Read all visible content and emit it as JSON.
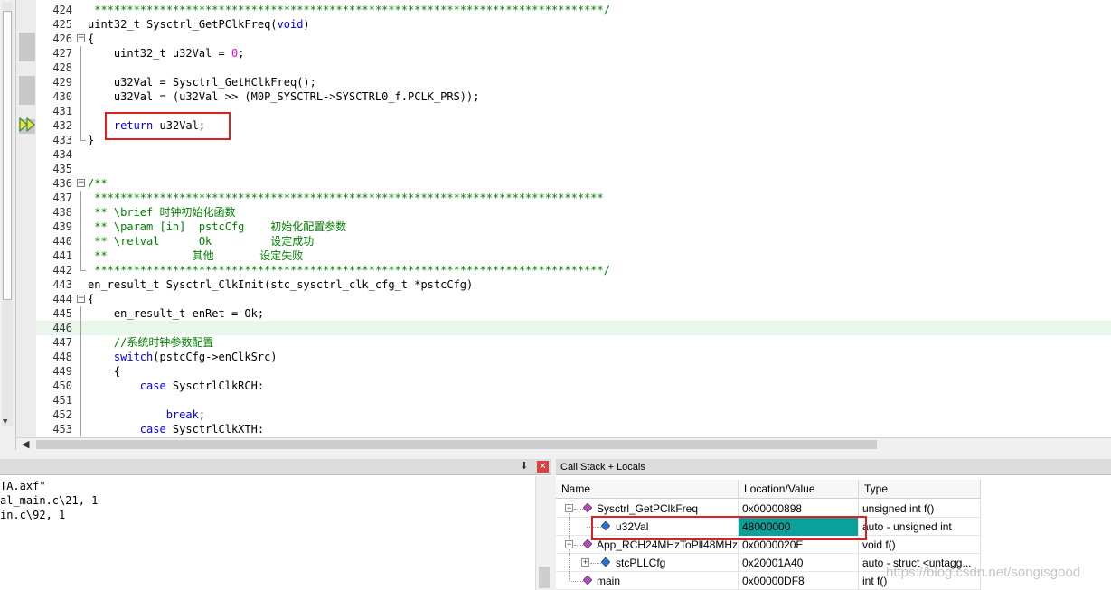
{
  "editor": {
    "lines": [
      {
        "n": "424",
        "segs": [
          {
            "t": " ******************************************************************************/",
            "c": "cmt"
          }
        ]
      },
      {
        "n": "425",
        "segs": [
          {
            "t": "uint32_t Sysctrl_GetPClkFreq(",
            "c": ""
          },
          {
            "t": "void",
            "c": "kw"
          },
          {
            "t": ")",
            "c": ""
          }
        ]
      },
      {
        "n": "426",
        "segs": [
          {
            "t": "{",
            "c": ""
          }
        ]
      },
      {
        "n": "427",
        "segs": [
          {
            "t": "    uint32_t u32Val = ",
            "c": ""
          },
          {
            "t": "0",
            "c": "num"
          },
          {
            "t": ";",
            "c": ""
          }
        ]
      },
      {
        "n": "428",
        "segs": []
      },
      {
        "n": "429",
        "segs": [
          {
            "t": "    u32Val = Sysctrl_GetHClkFreq();",
            "c": ""
          }
        ]
      },
      {
        "n": "430",
        "segs": [
          {
            "t": "    u32Val = (u32Val >> (M0P_SYSCTRL->SYSCTRL0_f.PCLK_PRS));",
            "c": ""
          }
        ]
      },
      {
        "n": "431",
        "segs": []
      },
      {
        "n": "432",
        "segs": [
          {
            "t": "    ",
            "c": ""
          },
          {
            "t": "return",
            "c": "kw"
          },
          {
            "t": " u32Val;",
            "c": ""
          }
        ]
      },
      {
        "n": "433",
        "segs": [
          {
            "t": "}",
            "c": ""
          }
        ]
      },
      {
        "n": "434",
        "segs": []
      },
      {
        "n": "435",
        "segs": []
      },
      {
        "n": "436",
        "segs": [
          {
            "t": "/**",
            "c": "cmt"
          }
        ]
      },
      {
        "n": "437",
        "segs": [
          {
            "t": " ******************************************************************************",
            "c": "cmt"
          }
        ]
      },
      {
        "n": "438",
        "segs": [
          {
            "t": " ** \\brief ",
            "c": "cmt"
          },
          {
            "t": "时钟初始化函数",
            "c": "cmt cjk"
          }
        ]
      },
      {
        "n": "439",
        "segs": [
          {
            "t": " ** \\param [in]  pstcCfg    ",
            "c": "cmt"
          },
          {
            "t": "初始化配置参数",
            "c": "cmt cjk"
          }
        ]
      },
      {
        "n": "440",
        "segs": [
          {
            "t": " ** \\retval      Ok         ",
            "c": "cmt"
          },
          {
            "t": "设定成功",
            "c": "cmt cjk"
          }
        ]
      },
      {
        "n": "441",
        "segs": [
          {
            "t": " **             ",
            "c": "cmt"
          },
          {
            "t": "其他",
            "c": "cmt cjk"
          },
          {
            "t": "       ",
            "c": "cmt"
          },
          {
            "t": "设定失败",
            "c": "cmt cjk"
          }
        ]
      },
      {
        "n": "442",
        "segs": [
          {
            "t": " ******************************************************************************/",
            "c": "cmt"
          }
        ]
      },
      {
        "n": "443",
        "segs": [
          {
            "t": "en_result_t Sysctrl_ClkInit(stc_sysctrl_clk_cfg_t *pstcCfg)",
            "c": ""
          }
        ]
      },
      {
        "n": "444",
        "segs": [
          {
            "t": "{",
            "c": ""
          }
        ]
      },
      {
        "n": "445",
        "segs": [
          {
            "t": "    en_result_t enRet = Ok;",
            "c": ""
          }
        ]
      },
      {
        "n": "446",
        "segs": []
      },
      {
        "n": "447",
        "segs": [
          {
            "t": "    //",
            "c": "cmt"
          },
          {
            "t": "系统时钟参数配置",
            "c": "cmt cjk"
          }
        ]
      },
      {
        "n": "448",
        "segs": [
          {
            "t": "    ",
            "c": ""
          },
          {
            "t": "switch",
            "c": "kw"
          },
          {
            "t": "(pstcCfg->enClkSrc)",
            "c": ""
          }
        ]
      },
      {
        "n": "449",
        "segs": [
          {
            "t": "    {",
            "c": ""
          }
        ]
      },
      {
        "n": "450",
        "segs": [
          {
            "t": "        ",
            "c": ""
          },
          {
            "t": "case",
            "c": "kw"
          },
          {
            "t": " SysctrlClkRCH:",
            "c": ""
          }
        ]
      },
      {
        "n": "451",
        "segs": []
      },
      {
        "n": "452",
        "segs": [
          {
            "t": "            ",
            "c": ""
          },
          {
            "t": "break",
            "c": "kw"
          },
          {
            "t": ";",
            "c": ""
          }
        ]
      },
      {
        "n": "453",
        "segs": [
          {
            "t": "        ",
            "c": ""
          },
          {
            "t": "case",
            "c": "kw"
          },
          {
            "t": " SysctrlClkXTH:",
            "c": ""
          }
        ]
      }
    ]
  },
  "output": {
    "lines": [
      "TA.axf\"",
      "al_main.c\\21, 1",
      "in.c\\92, 1"
    ],
    "pin_glyph": "⬇",
    "close_glyph": "✕"
  },
  "callstack": {
    "title": "Call Stack + Locals",
    "columns": {
      "name": "Name",
      "value": "Location/Value",
      "type": "Type"
    },
    "rows": [
      {
        "name": "Sysctrl_GetPClkFreq",
        "value": "0x00000898",
        "type": "unsigned int f()",
        "icon": "function-icon",
        "toggle": "−"
      },
      {
        "name": "u32Val",
        "value": "48000000",
        "type": "auto - unsigned int",
        "icon": "variable-icon",
        "toggle": ""
      },
      {
        "name": "App_RCH24MHzToPll48MHz",
        "value": "0x0000020E",
        "type": "void f()",
        "icon": "function-icon",
        "toggle": "−"
      },
      {
        "name": "stcPLLCfg",
        "value": "0x20001A40",
        "type": "auto - struct <untagg...",
        "icon": "variable-icon",
        "toggle": "+"
      },
      {
        "name": "main",
        "value": "0x00000DF8",
        "type": "int f()",
        "icon": "function-icon",
        "toggle": ""
      }
    ]
  },
  "colors": {
    "selected_value_bg": "#0aa19a",
    "annotation_box": "#e02020",
    "comment": "#008000",
    "keyword": "#0000ff"
  },
  "watermark": "https://blog.csdn.net/songisgood"
}
